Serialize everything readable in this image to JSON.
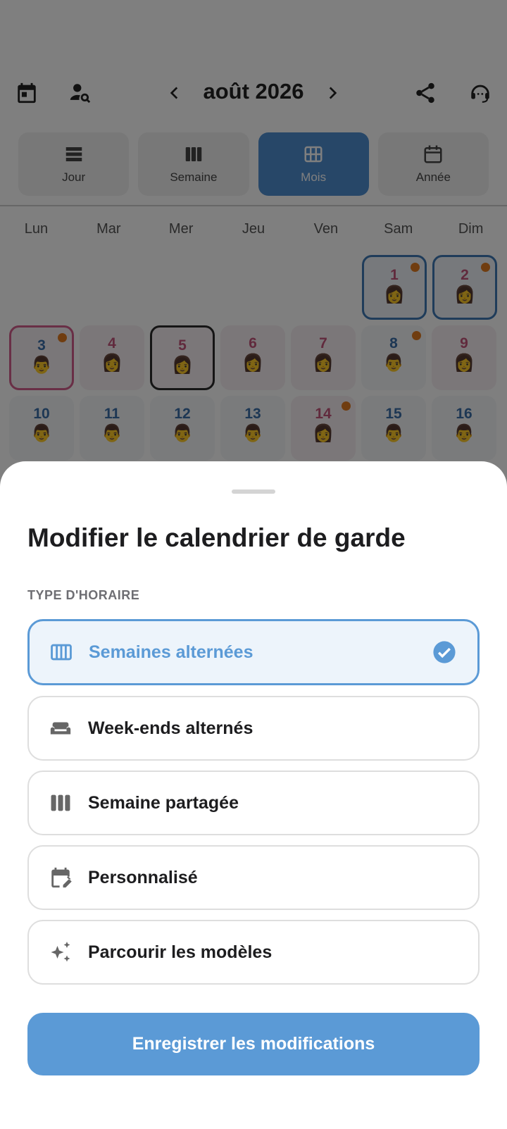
{
  "calendar": {
    "month_title": "août 2026",
    "views": [
      {
        "label": "Jour",
        "icon": "day-view-icon"
      },
      {
        "label": "Semaine",
        "icon": "week-view-icon"
      },
      {
        "label": "Mois",
        "icon": "month-view-icon",
        "active": true
      },
      {
        "label": "Année",
        "icon": "year-view-icon"
      }
    ],
    "weekdays": [
      "Lun",
      "Mar",
      "Mer",
      "Jeu",
      "Ven",
      "Sam",
      "Dim"
    ],
    "days": [
      {
        "n": "1",
        "emoji": "👩"
      },
      {
        "n": "2",
        "emoji": "👩"
      },
      {
        "n": "3",
        "emoji": "👨"
      },
      {
        "n": "4",
        "emoji": "👩"
      },
      {
        "n": "5",
        "emoji": "👩"
      },
      {
        "n": "6",
        "emoji": "👩"
      },
      {
        "n": "7",
        "emoji": "👩"
      },
      {
        "n": "8",
        "emoji": "👨"
      },
      {
        "n": "9",
        "emoji": "👩"
      },
      {
        "n": "10",
        "emoji": "👨"
      },
      {
        "n": "11",
        "emoji": "👨"
      },
      {
        "n": "12",
        "emoji": "👨"
      },
      {
        "n": "13",
        "emoji": "👨"
      },
      {
        "n": "14",
        "emoji": "👩"
      },
      {
        "n": "15",
        "emoji": "👨"
      },
      {
        "n": "16",
        "emoji": "👨"
      }
    ]
  },
  "sheet": {
    "title": "Modifier le calendrier de garde",
    "section_label": "TYPE D'HORAIRE",
    "options": [
      {
        "label": "Semaines alternées",
        "icon": "columns-icon",
        "selected": true
      },
      {
        "label": "Week-ends alternés",
        "icon": "sofa-icon"
      },
      {
        "label": "Semaine partagée",
        "icon": "split-week-icon"
      },
      {
        "label": "Personnalisé",
        "icon": "edit-calendar-icon"
      },
      {
        "label": "Parcourir les modèles",
        "icon": "sparkle-icon"
      }
    ],
    "save_label": "Enregistrer les modifications"
  },
  "colors": {
    "accent": "#5b9ad6",
    "mother": "#c2557a",
    "father": "#3a6ea8",
    "event_dot": "#e07b20"
  }
}
